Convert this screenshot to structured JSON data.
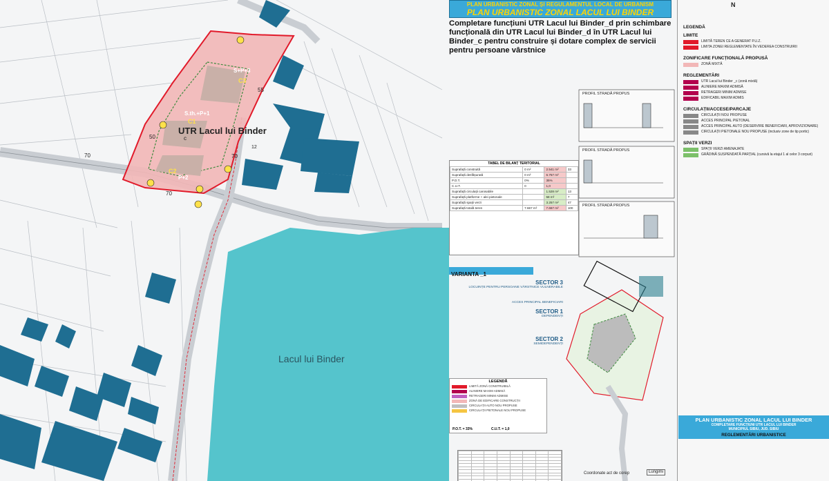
{
  "header": {
    "line1": "PLAN URBANISTIC ZONAL ȘI REGULAMENTUL LOCAL DE URBANISM",
    "line2": "PLAN URBANISTIC ZONAL LACUL LUI BINDER"
  },
  "subject": "Completare funcțiuni UTR Lacul lui Binder_d prin schimbare funcțională din UTR Lacul lui Binder_d în UTR Lacul lui Binder_c pentru construire și dotare complex de servicii pentru persoane vârstnice",
  "map_labels": {
    "utr": "UTR Lacul lui Binder",
    "utr_sub": "c",
    "lake": "Lacul lui Binder",
    "c1": "C1",
    "c2": "C2",
    "c3": "C3",
    "h_c3": "S+P+3",
    "h_c1": "S.th.+P+1",
    "h_c2": "P+2",
    "road_70a": "70",
    "road_70b": "70",
    "road_70c": "70",
    "road_50": "50",
    "road_55": "55",
    "road_12": "12"
  },
  "legend": {
    "title": "LEGENDĂ",
    "sections": [
      {
        "label": "LIMITE",
        "items": [
          "LIMITĂ TEREN CE A GENERAT P.U.Z.",
          "LIMITA ZONEI REGLEMENTATE ÎN VEDEREA CONSTRUIRII"
        ]
      },
      {
        "label": "ZONIFICARE FUNCȚIONALĂ PROPUSĂ",
        "items": [
          "ZONĂ MIXTĂ"
        ]
      },
      {
        "label": "REGLEMENTĂRI",
        "items": [
          "UTR Lacul lui Binder _c (zonă mixtă)",
          "ALINIERE MAXIM ADMISĂ",
          "RETRAGERI MINIM ADMISE",
          "EDIFICABIL MAXIM ADMIS"
        ]
      },
      {
        "label": "CIRCULAȚII/ACCESE/PARCAJE",
        "items": [
          "CIRCULAȚII NOU PROPUSE",
          "ACCES PRINCIPAL PIETONAL",
          "ACCES PRINCIPAL AUTO (DESERVIRE BENEFICIARI, APROVIZIONARE)",
          "CIRCULAȚII PIETONALE NOU PROPUSE (inclusiv zone de tip portic)"
        ]
      },
      {
        "label": "SPAȚII VERZI",
        "items": [
          "SPAȚII VERZI AMENAJATE",
          "GRĂDINĂ SUSPENDATĂ PARȚIAL (cursivă la etajul 1 al celor 3 corpuri)"
        ]
      }
    ]
  },
  "profiles": [
    "PROFIL STRADĂ PROPUS",
    "PROFIL STRADĂ PROPUS",
    "PROFIL STRADĂ PROPUS"
  ],
  "table": {
    "title": "TABEL DE BILANȚ TERITORIAL",
    "rows": [
      [
        "Suprafață construită",
        "0 m²",
        "2.541 m²",
        "33"
      ],
      [
        "Suprafață desfășurată",
        "0 m²",
        "6.757 m²",
        ""
      ],
      [
        "P.O.T.",
        "0%",
        "35%",
        ""
      ],
      [
        "C.U.T.",
        "0",
        "1,0",
        ""
      ],
      [
        "Suprafață circulații carosabile",
        "",
        "1.528 m²",
        "13"
      ],
      [
        "Suprafață platforme + alei pietonale",
        "",
        "58 m²",
        "7"
      ],
      [
        "Suprafață spații verzi",
        "",
        "3.257 m²",
        "47"
      ],
      [
        "Suprafață totală teren",
        "7.667 m²",
        "7.667 m²",
        "100"
      ]
    ]
  },
  "variant": {
    "label": "VARIANTA _1",
    "sectors": [
      {
        "name": "SECTOR 3",
        "desc": "LOCUINȚE PENTRU PERSOANE VÂRSTNICE VULNERABILE",
        "code": "C3"
      },
      {
        "name": "SECTOR 1",
        "desc": "DEPENDENȚI",
        "code": "C1"
      },
      {
        "name": "SECTOR 2",
        "desc": "SEMIDEPENDENȚI",
        "code": "C2"
      }
    ],
    "access_label": "ACCES PRINCIPAL BENEFICIARI"
  },
  "legend2": {
    "title": "LEGENDĂ",
    "rows": [
      "LIMITĂ ZONĂ CONSTRUIBILĂ",
      "ALINIERE MAXIM ADMISĂ",
      "RETRAGERI MINIM ADMISE",
      "ZONĂ DE EDIFICARE CONSTRUCȚII",
      "CIRCULAȚII AUTO NOU PROPUSE",
      "CIRCULAȚII PIETONALE NOU PROPUSE"
    ],
    "pot": "P.O.T. = 33%",
    "cut": "C.U.T. = 1,0"
  },
  "bottom": {
    "title": "PLAN URBANISTIC ZONAL LACUL LUI BINDER",
    "sub1": "COMPLETARE FUNCȚIUNI UTR LACUL LUI BINDER",
    "sub2": "MUNICIPIUL SIBIU, JUD. SIBIU",
    "reg": "REGLEMENTĂRI URBANISTICE"
  },
  "coord_label": "Coordonate act de corep",
  "length_label": "Lungimi",
  "north": "N",
  "colors": {
    "lake": "#55c4cc",
    "building": "#1f6e92",
    "zone_fill": "#f2b7b7",
    "boundary": "#e11a2a",
    "band": "#3aa9d9",
    "title_yellow": "#ffd400"
  }
}
